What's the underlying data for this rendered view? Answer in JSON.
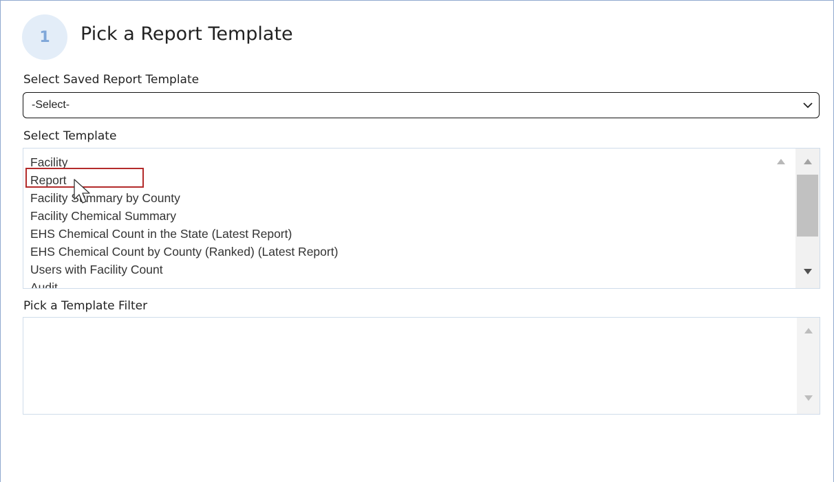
{
  "step": {
    "number": "1",
    "title": "Pick a Report Template"
  },
  "saved_template": {
    "label": "Select Saved Report Template",
    "selected": "-Select-"
  },
  "template": {
    "label": "Select Template",
    "options": [
      "Facility",
      "Report",
      "Facility Summary by County",
      "Facility Chemical Summary",
      "EHS Chemical Count in the State (Latest Report)",
      "EHS Chemical Count by County (Ranked) (Latest Report)",
      "Users with Facility Count",
      "Audit"
    ],
    "highlighted": "Report"
  },
  "filter": {
    "label": "Pick a Template Filter"
  },
  "colors": {
    "highlight": "#b32a2a",
    "step_circle": "#e3edf8",
    "step_number": "#7fa7d9"
  },
  "icons": [
    "chevron-down-icon",
    "scroll-up-arrow-icon",
    "scroll-down-arrow-icon",
    "mouse-pointer-icon"
  ]
}
